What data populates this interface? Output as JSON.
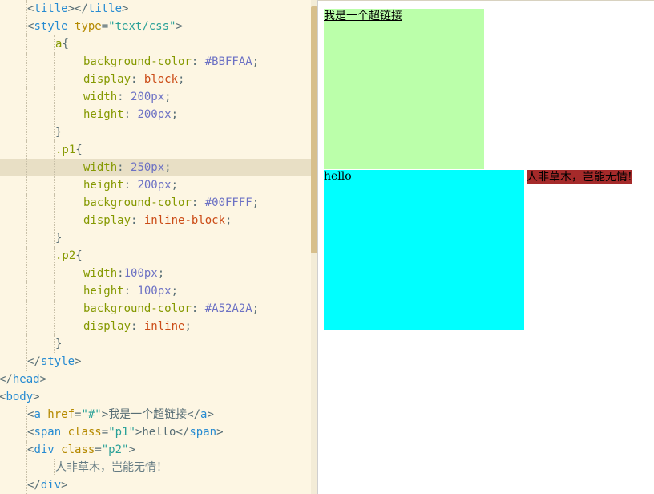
{
  "editor": {
    "lines": [
      {
        "indent": 1,
        "tokens": [
          [
            "punc",
            "<"
          ],
          [
            "tag",
            "title"
          ],
          [
            "punc",
            "></"
          ],
          [
            "tag",
            "title"
          ],
          [
            "punc",
            ">"
          ]
        ]
      },
      {
        "indent": 1,
        "tokens": [
          [
            "punc",
            "<"
          ],
          [
            "tag",
            "style "
          ],
          [
            "attr",
            "type"
          ],
          [
            "punc",
            "="
          ],
          [
            "str",
            "\"text/css\""
          ],
          [
            "punc",
            ">"
          ]
        ]
      },
      {
        "indent": 2,
        "tokens": [
          [
            "sel",
            "a"
          ],
          [
            "punc",
            "{"
          ]
        ]
      },
      {
        "indent": 3,
        "tokens": [
          [
            "prop",
            "background-color"
          ],
          [
            "punc",
            ": "
          ],
          [
            "num",
            "#BBFFAA"
          ],
          [
            "punc",
            ";"
          ]
        ]
      },
      {
        "indent": 3,
        "tokens": [
          [
            "prop",
            "display"
          ],
          [
            "punc",
            ": "
          ],
          [
            "kw",
            "block"
          ],
          [
            "punc",
            ";"
          ]
        ]
      },
      {
        "indent": 3,
        "tokens": [
          [
            "prop",
            "width"
          ],
          [
            "punc",
            ": "
          ],
          [
            "num",
            "200px"
          ],
          [
            "punc",
            ";"
          ]
        ]
      },
      {
        "indent": 3,
        "tokens": [
          [
            "prop",
            "height"
          ],
          [
            "punc",
            ": "
          ],
          [
            "num",
            "200px"
          ],
          [
            "punc",
            ";"
          ]
        ]
      },
      {
        "indent": 2,
        "tokens": [
          [
            "punc",
            "}"
          ]
        ]
      },
      {
        "indent": 2,
        "tokens": [
          [
            "sel",
            ".p1"
          ],
          [
            "punc",
            "{"
          ]
        ]
      },
      {
        "indent": 3,
        "highlight": true,
        "tokens": [
          [
            "prop",
            "width"
          ],
          [
            "punc",
            ": "
          ],
          [
            "num",
            "250px"
          ],
          [
            "punc",
            ";"
          ]
        ]
      },
      {
        "indent": 3,
        "tokens": [
          [
            "prop",
            "height"
          ],
          [
            "punc",
            ": "
          ],
          [
            "num",
            "200px"
          ],
          [
            "punc",
            ";"
          ]
        ]
      },
      {
        "indent": 3,
        "tokens": [
          [
            "prop",
            "background-color"
          ],
          [
            "punc",
            ": "
          ],
          [
            "num",
            "#00FFFF"
          ],
          [
            "punc",
            ";"
          ]
        ]
      },
      {
        "indent": 3,
        "tokens": [
          [
            "prop",
            "display"
          ],
          [
            "punc",
            ": "
          ],
          [
            "kw",
            "inline-block"
          ],
          [
            "punc",
            ";"
          ]
        ]
      },
      {
        "indent": 2,
        "tokens": [
          [
            "punc",
            "}"
          ]
        ]
      },
      {
        "indent": 2,
        "tokens": [
          [
            "sel",
            ".p2"
          ],
          [
            "punc",
            "{"
          ]
        ]
      },
      {
        "indent": 3,
        "tokens": [
          [
            "prop",
            "width"
          ],
          [
            "punc",
            ":"
          ],
          [
            "num",
            "100px"
          ],
          [
            "punc",
            ";"
          ]
        ]
      },
      {
        "indent": 3,
        "tokens": [
          [
            "prop",
            "height"
          ],
          [
            "punc",
            ": "
          ],
          [
            "num",
            "100px"
          ],
          [
            "punc",
            ";"
          ]
        ]
      },
      {
        "indent": 3,
        "tokens": [
          [
            "prop",
            "background-color"
          ],
          [
            "punc",
            ": "
          ],
          [
            "num",
            "#A52A2A"
          ],
          [
            "punc",
            ";"
          ]
        ]
      },
      {
        "indent": 3,
        "tokens": [
          [
            "prop",
            "display"
          ],
          [
            "punc",
            ": "
          ],
          [
            "kw",
            "inline"
          ],
          [
            "punc",
            ";"
          ]
        ]
      },
      {
        "indent": 2,
        "tokens": [
          [
            "punc",
            "}"
          ]
        ]
      },
      {
        "indent": 1,
        "tokens": [
          [
            "punc",
            "</"
          ],
          [
            "tag",
            "style"
          ],
          [
            "punc",
            ">"
          ]
        ]
      },
      {
        "indent": 0,
        "tokens": [
          [
            "punc",
            "</"
          ],
          [
            "tag",
            "head"
          ],
          [
            "punc",
            ">"
          ]
        ]
      },
      {
        "indent": 0,
        "tokens": [
          [
            "punc",
            "<"
          ],
          [
            "tag",
            "body"
          ],
          [
            "punc",
            ">"
          ]
        ]
      },
      {
        "indent": 1,
        "tokens": [
          [
            "punc",
            "<"
          ],
          [
            "tag",
            "a "
          ],
          [
            "attr",
            "href"
          ],
          [
            "punc",
            "="
          ],
          [
            "str",
            "\"#\""
          ],
          [
            "punc",
            ">"
          ],
          [
            "text",
            "我是一个超链接"
          ],
          [
            "punc",
            "</"
          ],
          [
            "tag",
            "a"
          ],
          [
            "punc",
            ">"
          ]
        ]
      },
      {
        "indent": 1,
        "tokens": [
          [
            "punc",
            "<"
          ],
          [
            "tag",
            "span "
          ],
          [
            "attr",
            "class"
          ],
          [
            "punc",
            "="
          ],
          [
            "str",
            "\"p1\""
          ],
          [
            "punc",
            ">"
          ],
          [
            "text",
            "hello"
          ],
          [
            "punc",
            "</"
          ],
          [
            "tag",
            "span"
          ],
          [
            "punc",
            ">"
          ]
        ]
      },
      {
        "indent": 1,
        "tokens": [
          [
            "punc",
            "<"
          ],
          [
            "tag",
            "div "
          ],
          [
            "attr",
            "class"
          ],
          [
            "punc",
            "="
          ],
          [
            "str",
            "\"p2\""
          ],
          [
            "punc",
            ">"
          ]
        ]
      },
      {
        "indent": 2,
        "tokens": [
          [
            "plain",
            "人非草木，岂能无情！"
          ]
        ]
      },
      {
        "indent": 1,
        "tokens": [
          [
            "punc",
            "</"
          ],
          [
            "tag",
            "div"
          ],
          [
            "punc",
            ">"
          ]
        ]
      }
    ]
  },
  "preview": {
    "link_text": "我是一个超链接",
    "span_text": "hello",
    "div_text": "人非草木，岂能无情!",
    "colors": {
      "link_bg": "#BBFFAA",
      "span_bg": "#00FFFF",
      "div_bg": "#A52A2A"
    }
  }
}
